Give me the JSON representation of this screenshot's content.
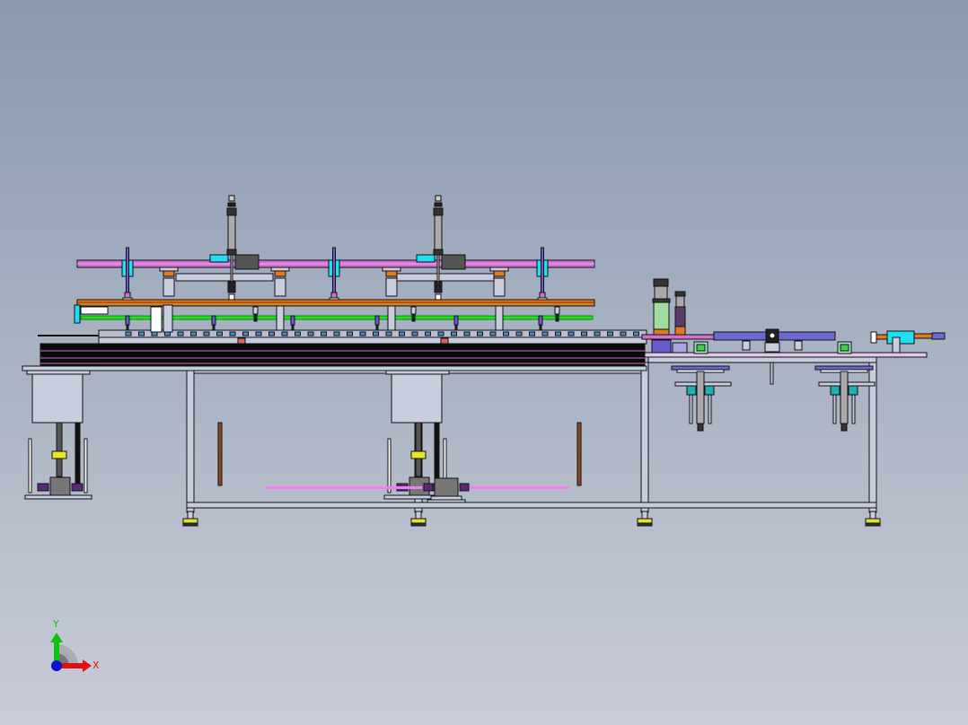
{
  "viewport": {
    "background_top": "#8899ae",
    "background_bottom": "#c8ccd7"
  },
  "triad": {
    "x_label": "X",
    "y_label": "Y",
    "x_color": "#e01010",
    "y_color": "#10c010",
    "z_color": "#1010d0"
  },
  "colors": {
    "rail_pink": "#d070d0",
    "rail_orange": "#e07a20",
    "rail_green": "#20e020",
    "frame": "#c8cdde",
    "cyan": "#20e0f0",
    "purple_rod": "#6a5ad0"
  }
}
